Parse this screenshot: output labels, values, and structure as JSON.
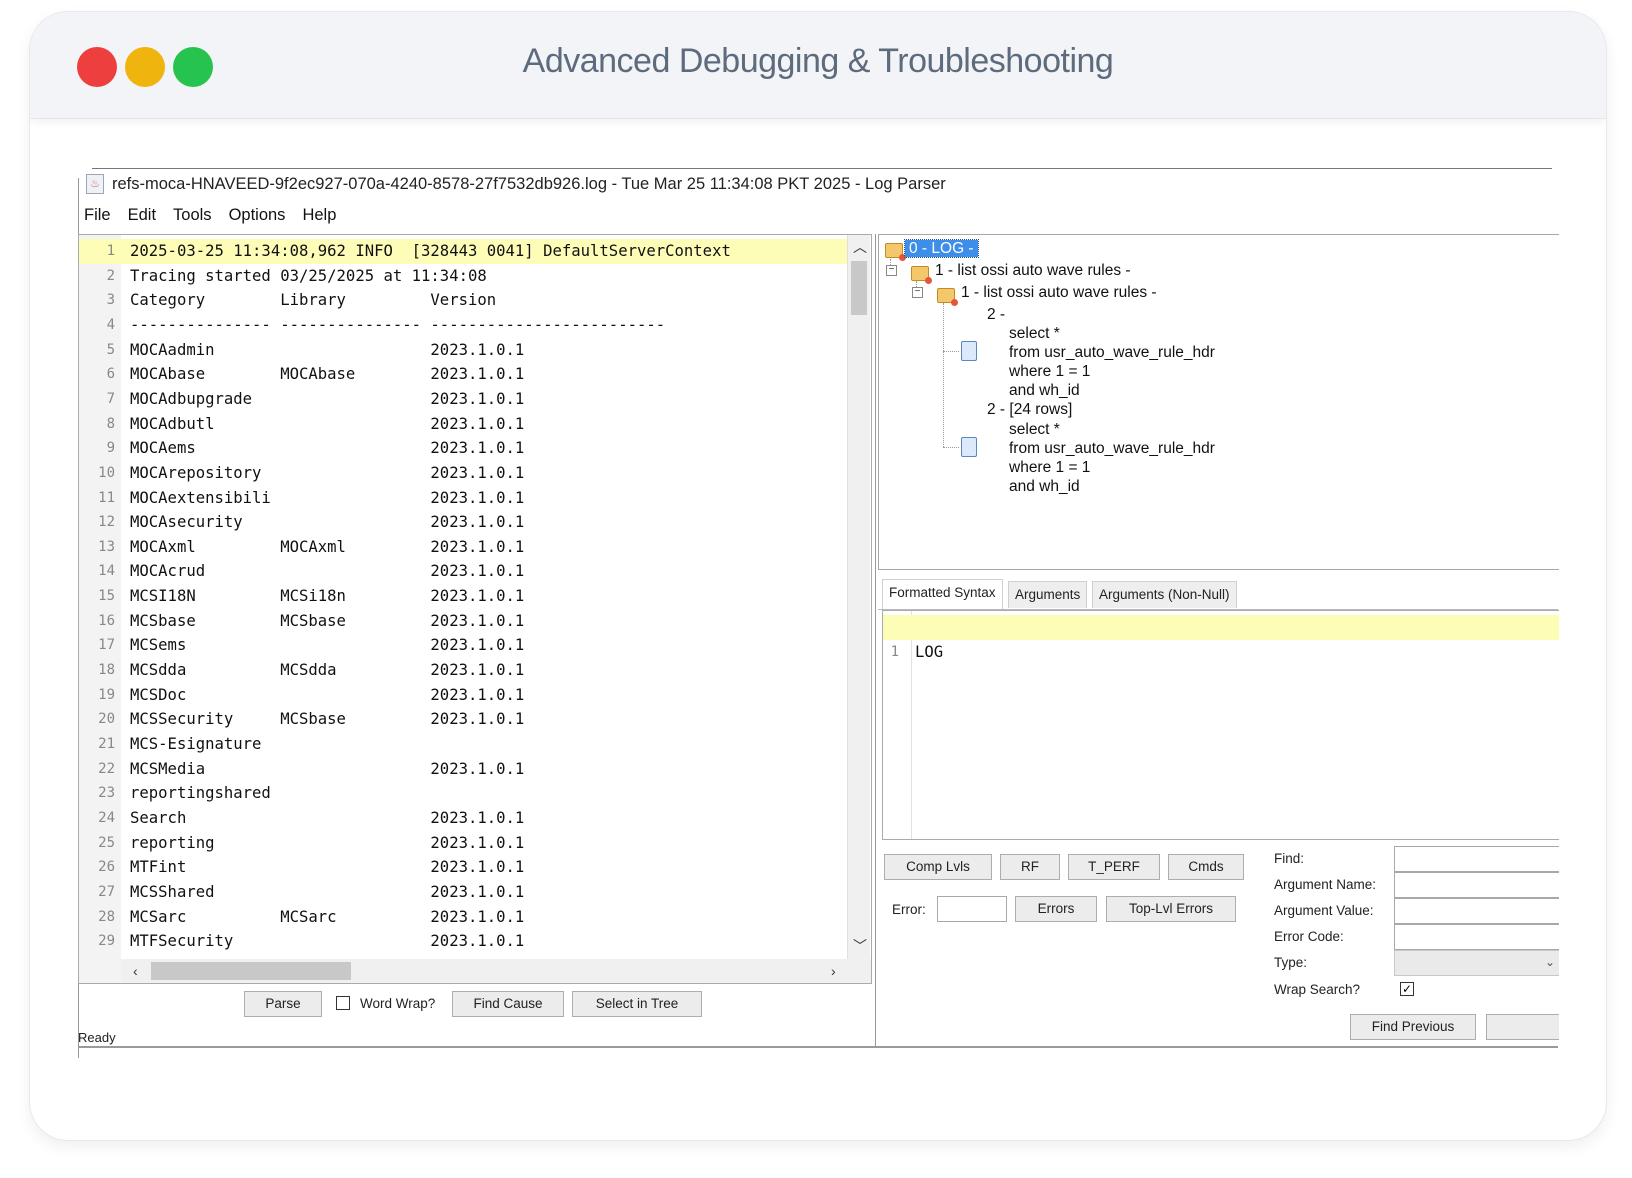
{
  "header": {
    "title": "Advanced Debugging & Troubleshooting"
  },
  "window": {
    "title": "refs-moca-HNAVEED-9f2ec927-070a-4240-8578-27f7532db926.log - Tue Mar 25 11:34:08 PKT 2025 - Log Parser"
  },
  "menu": [
    "File",
    "Edit",
    "Tools",
    "Options",
    "Help"
  ],
  "editor": {
    "lines": [
      {
        "n": "1",
        "text": "2025-03-25 11:34:08,962 INFO  [328443 0041] DefaultServerContext"
      },
      {
        "n": "2",
        "text": "Tracing started 03/25/2025 at 11:34:08"
      },
      {
        "n": "3",
        "text": "Category        Library         Version"
      },
      {
        "n": "4",
        "text": "--------------- --------------- -------------------------"
      },
      {
        "n": "5",
        "text": "MOCAadmin                       2023.1.0.1"
      },
      {
        "n": "6",
        "text": "MOCAbase        MOCAbase        2023.1.0.1"
      },
      {
        "n": "7",
        "text": "MOCAdbupgrade                   2023.1.0.1"
      },
      {
        "n": "8",
        "text": "MOCAdbutl                       2023.1.0.1"
      },
      {
        "n": "9",
        "text": "MOCAems                         2023.1.0.1"
      },
      {
        "n": "10",
        "text": "MOCArepository                  2023.1.0.1"
      },
      {
        "n": "11",
        "text": "MOCAextensibili                 2023.1.0.1"
      },
      {
        "n": "12",
        "text": "MOCAsecurity                    2023.1.0.1"
      },
      {
        "n": "13",
        "text": "MOCAxml         MOCAxml         2023.1.0.1"
      },
      {
        "n": "14",
        "text": "MOCAcrud                        2023.1.0.1"
      },
      {
        "n": "15",
        "text": "MCSI18N         MCSi18n         2023.1.0.1"
      },
      {
        "n": "16",
        "text": "MCSbase         MCSbase         2023.1.0.1"
      },
      {
        "n": "17",
        "text": "MCSems                          2023.1.0.1"
      },
      {
        "n": "18",
        "text": "MCSdda          MCSdda          2023.1.0.1"
      },
      {
        "n": "19",
        "text": "MCSDoc                          2023.1.0.1"
      },
      {
        "n": "20",
        "text": "MCSSecurity     MCSbase         2023.1.0.1"
      },
      {
        "n": "21",
        "text": "MCS-Esignature"
      },
      {
        "n": "22",
        "text": "MCSMedia                        2023.1.0.1"
      },
      {
        "n": "23",
        "text": "reportingshared"
      },
      {
        "n": "24",
        "text": "Search                          2023.1.0.1"
      },
      {
        "n": "25",
        "text": "reporting                       2023.1.0.1"
      },
      {
        "n": "26",
        "text": "MTFint                          2023.1.0.1"
      },
      {
        "n": "27",
        "text": "MCSShared                       2023.1.0.1"
      },
      {
        "n": "28",
        "text": "MCSarc          MCSarc          2023.1.0.1"
      },
      {
        "n": "29",
        "text": "MTFSecurity                     2023.1.0.1"
      }
    ]
  },
  "bottom_left": {
    "parse": "Parse",
    "word_wrap": "Word Wrap?",
    "find_cause": "Find Cause",
    "select_in_tree": "Select in Tree",
    "status": "Ready"
  },
  "tree": {
    "root": "0 - LOG -",
    "n1": "1 - list ossi auto wave rules -",
    "n2": "1 - list ossi auto wave rules -",
    "n3_label": "2 -",
    "n3_sql": [
      "select *",
      "from usr_auto_wave_rule_hdr",
      "where 1 = 1",
      "and wh_id"
    ],
    "n4_label": "2 - [24 rows]",
    "n4_sql": [
      "select *",
      "from usr_auto_wave_rule_hdr",
      "where 1 = 1",
      "and wh_id"
    ]
  },
  "tabs": [
    "Formatted Syntax",
    "Arguments",
    "Arguments (Non-Null)"
  ],
  "syntax": {
    "line_no": "1",
    "text": "LOG"
  },
  "actions": {
    "comp_lvls": "Comp Lvls",
    "rf": "RF",
    "t_perf": "T_PERF",
    "cmds": "Cmds",
    "error_label": "Error:",
    "errors": "Errors",
    "top_lvl_errors": "Top-Lvl Errors"
  },
  "search": {
    "find": "Find:",
    "argument_name": "Argument Name:",
    "argument_value": "Argument Value:",
    "error_code": "Error Code:",
    "type": "Type:",
    "wrap_search": "Wrap Search?",
    "find_previous": "Find Previous"
  }
}
